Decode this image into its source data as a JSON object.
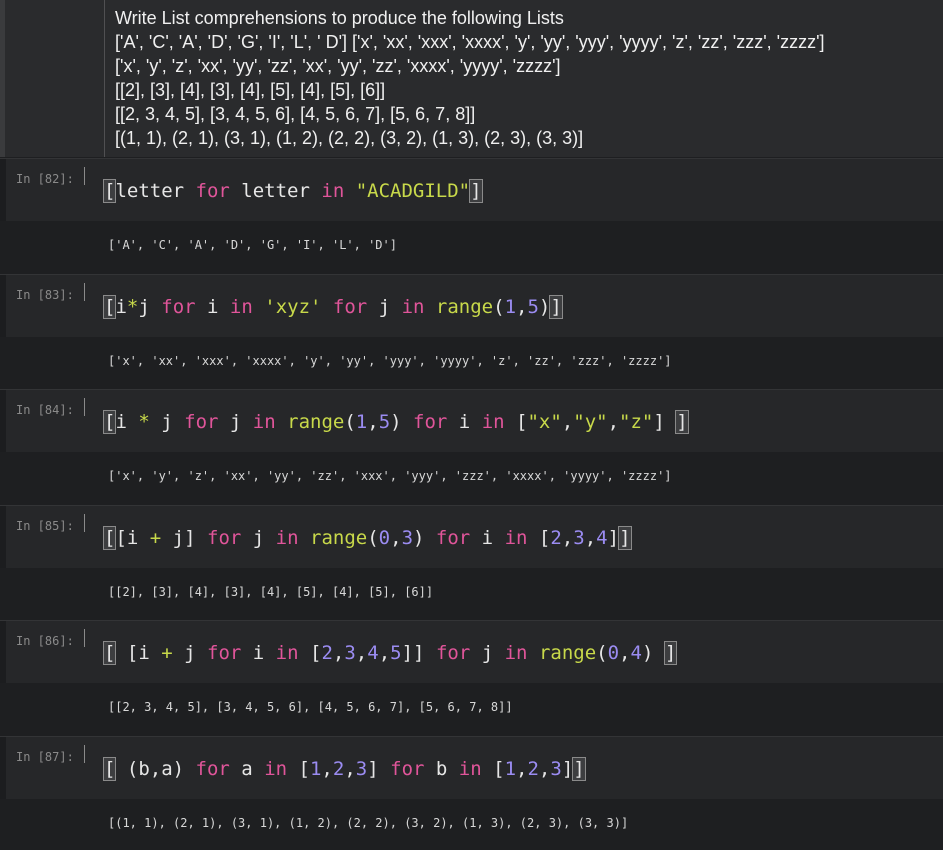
{
  "markdown": {
    "lines": [
      "Write List comprehensions to produce the following Lists",
      "['A', 'C', 'A', 'D', 'G', 'I', 'L', ' D'] ['x', 'xx', 'xxx', 'xxxx', 'y', 'yy', 'yyy', 'yyyy', 'z', 'zz', 'zzz', 'zzzz']",
      "['x', 'y', 'z', 'xx', 'yy', 'zz', 'xx', 'yy', 'zz', 'xxxx', 'yyyy', 'zzzz']",
      "[[2], [3], [4], [3], [4], [5], [4], [5], [6]]",
      "[[2, 3, 4, 5], [3, 4, 5, 6], [4, 5, 6, 7], [5, 6, 7, 8]]",
      "[(1, 1), (2, 1), (3, 1), (1, 2), (2, 2), (3, 2), (1, 3), (2, 3), (3, 3)]"
    ]
  },
  "cells": [
    {
      "prompt": "In [82]:",
      "tokens": [
        {
          "t": "[",
          "c": "bracket"
        },
        {
          "t": "letter ",
          "c": ""
        },
        {
          "t": "for",
          "c": "kw"
        },
        {
          "t": " letter ",
          "c": ""
        },
        {
          "t": "in",
          "c": "kw"
        },
        {
          "t": " ",
          "c": ""
        },
        {
          "t": "\"ACADGILD\"",
          "c": "str"
        },
        {
          "t": "]",
          "c": "bracket"
        }
      ],
      "output": "['A', 'C', 'A', 'D', 'G', 'I', 'L', 'D']"
    },
    {
      "prompt": "In [83]:",
      "tokens": [
        {
          "t": "[",
          "c": "bracket"
        },
        {
          "t": "i",
          "c": ""
        },
        {
          "t": "*",
          "c": "op"
        },
        {
          "t": "j ",
          "c": ""
        },
        {
          "t": "for",
          "c": "kw"
        },
        {
          "t": " i ",
          "c": ""
        },
        {
          "t": "in",
          "c": "kw"
        },
        {
          "t": " ",
          "c": ""
        },
        {
          "t": "'xyz'",
          "c": "str"
        },
        {
          "t": " ",
          "c": ""
        },
        {
          "t": "for",
          "c": "kw"
        },
        {
          "t": " j ",
          "c": ""
        },
        {
          "t": "in",
          "c": "kw"
        },
        {
          "t": " ",
          "c": ""
        },
        {
          "t": "range",
          "c": "fn"
        },
        {
          "t": "(",
          "c": ""
        },
        {
          "t": "1",
          "c": "num"
        },
        {
          "t": ",",
          "c": ""
        },
        {
          "t": "5",
          "c": "num"
        },
        {
          "t": ")",
          "c": ""
        },
        {
          "t": "]",
          "c": "bracket"
        }
      ],
      "output": "['x', 'xx', 'xxx', 'xxxx', 'y', 'yy', 'yyy', 'yyyy', 'z', 'zz', 'zzz', 'zzzz']"
    },
    {
      "prompt": "In [84]:",
      "tokens": [
        {
          "t": "[",
          "c": "bracket"
        },
        {
          "t": "i ",
          "c": ""
        },
        {
          "t": "*",
          "c": "op"
        },
        {
          "t": " j ",
          "c": ""
        },
        {
          "t": "for",
          "c": "kw"
        },
        {
          "t": " j ",
          "c": ""
        },
        {
          "t": "in",
          "c": "kw"
        },
        {
          "t": " ",
          "c": ""
        },
        {
          "t": "range",
          "c": "fn"
        },
        {
          "t": "(",
          "c": ""
        },
        {
          "t": "1",
          "c": "num"
        },
        {
          "t": ",",
          "c": ""
        },
        {
          "t": "5",
          "c": "num"
        },
        {
          "t": ") ",
          "c": ""
        },
        {
          "t": "for",
          "c": "kw"
        },
        {
          "t": " i ",
          "c": ""
        },
        {
          "t": "in",
          "c": "kw"
        },
        {
          "t": " [",
          "c": ""
        },
        {
          "t": "\"x\"",
          "c": "str"
        },
        {
          "t": ",",
          "c": ""
        },
        {
          "t": "\"y\"",
          "c": "str"
        },
        {
          "t": ",",
          "c": ""
        },
        {
          "t": "\"z\"",
          "c": "str"
        },
        {
          "t": "] ",
          "c": ""
        },
        {
          "t": "]",
          "c": "bracket"
        }
      ],
      "output": "['x', 'y', 'z', 'xx', 'yy', 'zz', 'xxx', 'yyy', 'zzz', 'xxxx', 'yyyy', 'zzzz']"
    },
    {
      "prompt": "In [85]:",
      "tokens": [
        {
          "t": "[",
          "c": "bracket"
        },
        {
          "t": "[i ",
          "c": ""
        },
        {
          "t": "+",
          "c": "op"
        },
        {
          "t": " j] ",
          "c": ""
        },
        {
          "t": "for",
          "c": "kw"
        },
        {
          "t": " j ",
          "c": ""
        },
        {
          "t": "in",
          "c": "kw"
        },
        {
          "t": " ",
          "c": ""
        },
        {
          "t": "range",
          "c": "fn"
        },
        {
          "t": "(",
          "c": ""
        },
        {
          "t": "0",
          "c": "num"
        },
        {
          "t": ",",
          "c": ""
        },
        {
          "t": "3",
          "c": "num"
        },
        {
          "t": ") ",
          "c": ""
        },
        {
          "t": "for",
          "c": "kw"
        },
        {
          "t": " i ",
          "c": ""
        },
        {
          "t": "in",
          "c": "kw"
        },
        {
          "t": " [",
          "c": ""
        },
        {
          "t": "2",
          "c": "num"
        },
        {
          "t": ",",
          "c": ""
        },
        {
          "t": "3",
          "c": "num"
        },
        {
          "t": ",",
          "c": ""
        },
        {
          "t": "4",
          "c": "num"
        },
        {
          "t": "]",
          "c": ""
        },
        {
          "t": "]",
          "c": "bracket"
        }
      ],
      "output": "[[2], [3], [4], [3], [4], [5], [4], [5], [6]]"
    },
    {
      "prompt": "In [86]:",
      "tokens": [
        {
          "t": "[",
          "c": "bracket"
        },
        {
          "t": " [i ",
          "c": ""
        },
        {
          "t": "+",
          "c": "op"
        },
        {
          "t": " j ",
          "c": ""
        },
        {
          "t": "for",
          "c": "kw"
        },
        {
          "t": " i ",
          "c": ""
        },
        {
          "t": "in",
          "c": "kw"
        },
        {
          "t": " [",
          "c": ""
        },
        {
          "t": "2",
          "c": "num"
        },
        {
          "t": ",",
          "c": ""
        },
        {
          "t": "3",
          "c": "num"
        },
        {
          "t": ",",
          "c": ""
        },
        {
          "t": "4",
          "c": "num"
        },
        {
          "t": ",",
          "c": ""
        },
        {
          "t": "5",
          "c": "num"
        },
        {
          "t": "]] ",
          "c": ""
        },
        {
          "t": "for",
          "c": "kw"
        },
        {
          "t": " j ",
          "c": ""
        },
        {
          "t": "in",
          "c": "kw"
        },
        {
          "t": " ",
          "c": ""
        },
        {
          "t": "range",
          "c": "fn"
        },
        {
          "t": "(",
          "c": ""
        },
        {
          "t": "0",
          "c": "num"
        },
        {
          "t": ",",
          "c": ""
        },
        {
          "t": "4",
          "c": "num"
        },
        {
          "t": ") ",
          "c": ""
        },
        {
          "t": "]",
          "c": "bracket"
        }
      ],
      "output": "[[2, 3, 4, 5], [3, 4, 5, 6], [4, 5, 6, 7], [5, 6, 7, 8]]"
    },
    {
      "prompt": "In [87]:",
      "tokens": [
        {
          "t": "[",
          "c": "bracket"
        },
        {
          "t": " (b,a) ",
          "c": ""
        },
        {
          "t": "for",
          "c": "kw"
        },
        {
          "t": " a ",
          "c": ""
        },
        {
          "t": "in",
          "c": "kw"
        },
        {
          "t": " [",
          "c": ""
        },
        {
          "t": "1",
          "c": "num"
        },
        {
          "t": ",",
          "c": ""
        },
        {
          "t": "2",
          "c": "num"
        },
        {
          "t": ",",
          "c": ""
        },
        {
          "t": "3",
          "c": "num"
        },
        {
          "t": "] ",
          "c": ""
        },
        {
          "t": "for",
          "c": "kw"
        },
        {
          "t": " b ",
          "c": ""
        },
        {
          "t": "in",
          "c": "kw"
        },
        {
          "t": " [",
          "c": ""
        },
        {
          "t": "1",
          "c": "num"
        },
        {
          "t": ",",
          "c": ""
        },
        {
          "t": "2",
          "c": "num"
        },
        {
          "t": ",",
          "c": ""
        },
        {
          "t": "3",
          "c": "num"
        },
        {
          "t": "]",
          "c": ""
        },
        {
          "t": "]",
          "c": "bracket"
        }
      ],
      "output": "[(1, 1), (2, 1), (3, 1), (1, 2), (2, 2), (3, 2), (1, 3), (2, 3), (3, 3)]"
    }
  ]
}
